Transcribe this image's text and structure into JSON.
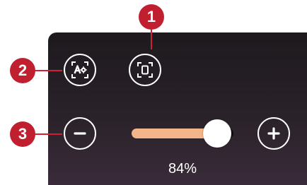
{
  "zoom": {
    "level_text": "84%",
    "level_percent": 84
  },
  "callouts": [
    {
      "number": "1"
    },
    {
      "number": "2"
    },
    {
      "number": "3"
    }
  ],
  "buttons": {
    "auto_fit_icon": "auto-fit-icon",
    "fit_screen_icon": "fit-screen-icon",
    "zoom_out_icon": "minus-icon",
    "zoom_in_icon": "plus-icon"
  },
  "colors": {
    "panel_bg": "#1d1a1e",
    "badge_red": "#c01f2f",
    "slider_fill": "#f4b58a",
    "slider_track": "#0e0c0e"
  }
}
